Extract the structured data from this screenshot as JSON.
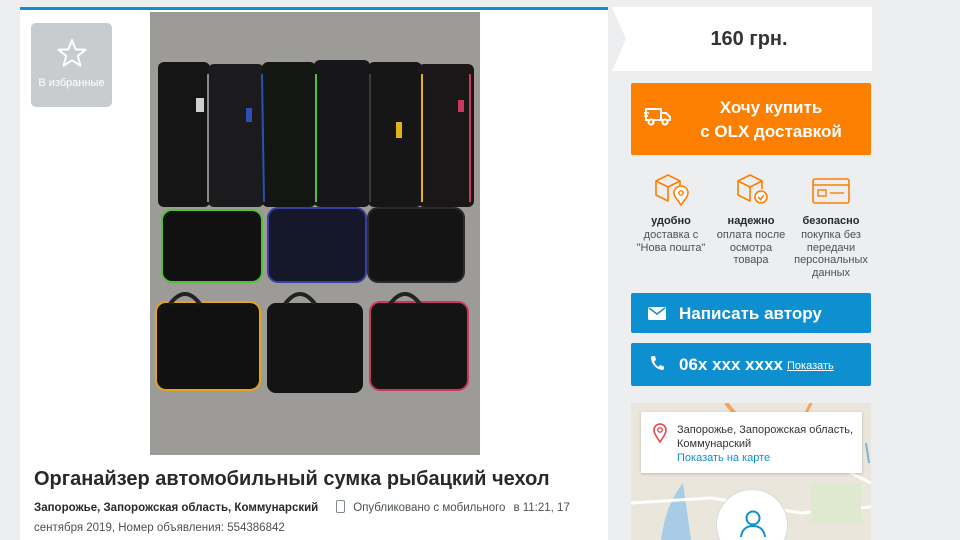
{
  "favorite": {
    "label": "В избранные",
    "icon": "star-icon"
  },
  "listing": {
    "title": "Органайзер автомобильный сумка рыбацкий чехол",
    "location": "Запорожье, Запорожская область, Коммунарский",
    "published_via": "Опубликовано с мобильного",
    "published_at": "в 11:21, 17 сентября 2019, Номер объявления: 554386842"
  },
  "price": "160 грн.",
  "buy_button": {
    "line1": "Хочу купить",
    "line2": "с OLX доставкой",
    "icon": "truck-icon"
  },
  "features": [
    {
      "title": "удобно",
      "desc": "доставка с \"Нова пошта\"",
      "icon": "box-pin-icon"
    },
    {
      "title": "надежно",
      "desc": "оплата после осмотра товара",
      "icon": "box-check-icon"
    },
    {
      "title": "безопасно",
      "desc": "покупка без передачи персональных данных",
      "icon": "card-icon"
    }
  ],
  "message_button": {
    "label": "Написать автору",
    "icon": "envelope-icon"
  },
  "phone_button": {
    "number": "06x xxx xxxx",
    "show_label": "Показать",
    "icon": "phone-icon"
  },
  "map": {
    "address": "Запорожье, Запорожская область, Коммунарский",
    "link": "Показать на карте",
    "icon": "location-pin-icon"
  },
  "colors": {
    "accent_blue": "#0e8fd0",
    "accent_orange": "#fc7f00"
  }
}
